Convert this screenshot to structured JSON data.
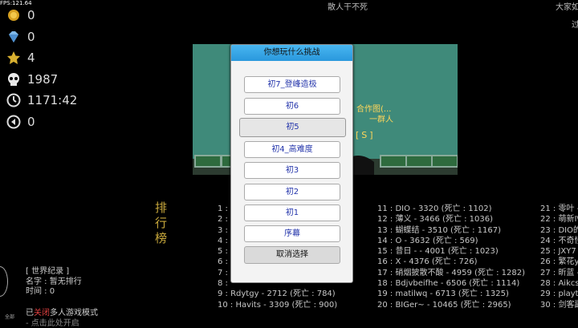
{
  "fps": "FPS:121.64",
  "stats": [
    {
      "icon": "coin-icon",
      "value": "0"
    },
    {
      "icon": "diamond-icon",
      "value": "0"
    },
    {
      "icon": "star-icon",
      "value": "4"
    },
    {
      "icon": "skull-icon",
      "value": "1987"
    },
    {
      "icon": "clock-icon",
      "value": "1171:42"
    },
    {
      "icon": "level-icon",
      "value": "0"
    }
  ],
  "header": {
    "title": "散人干不死",
    "right": "大家如",
    "right2": "过"
  },
  "scene": {
    "text1": "合作图(...",
    "text2": "一群人",
    "hint": "[S]"
  },
  "dialog": {
    "title": "你想玩什么挑战",
    "options": [
      "初7_登峰造极",
      "初6",
      "初5",
      "初4_高难度",
      "初3",
      "初2",
      "初1",
      "序幕"
    ],
    "cancel": "取消选择"
  },
  "ranking": {
    "title": "排行榜",
    "col1": [
      "1 : ",
      "2 : ",
      "3 : ",
      "4 : ",
      "5 : ",
      "6 : ",
      "7 : ",
      "8 : ",
      "9 : Rdytgy - 2712 (死亡 : 784)",
      "10 : Havits - 3309 (死亡 : 900)"
    ],
    "col2": [
      "11 : DIO - 3320 (死亡 : 1102)",
      "12 : 薄义 - 3466 (死亡 : 1036)",
      "13 : 蝴蝶结 - 3510 (死亡 : 1167)",
      "14 : O - 3632 (死亡 : 569)",
      "15 : 昔日 - - 4001 (死亡 : 1023)",
      "16 : X - 4376 (死亡 : 726)",
      "17 : 硝烟披散不酸 - 4959 (死亡 : 1282)",
      "18 : Bdjvbeifhe - 6506 (死亡 : 1114)",
      "19 : matilwq - 6713 (死亡 : 1325)",
      "20 : BIGer~ - 10465 (死亡 : 2965)"
    ],
    "col3": [
      "21 : 零叶 -",
      "22 : 萌新I\\",
      "23 : DIO的",
      "24 : 不奇怪",
      "25 : JXY7",
      "26 : 繁花y",
      "27 : 昕蓝 -",
      "28 : Aikcs",
      "29 : playtc",
      "30 : 剑客副"
    ]
  },
  "record": {
    "title": "[ 世界纪录 ]",
    "name": "名字 : 暂无排行",
    "time": "时间 : 0"
  },
  "mode": {
    "prefix": "已",
    "status": "关闭",
    "suffix": "多人游戏模式",
    "tap": "- 点击此处开启"
  },
  "avatar_label": "全部"
}
